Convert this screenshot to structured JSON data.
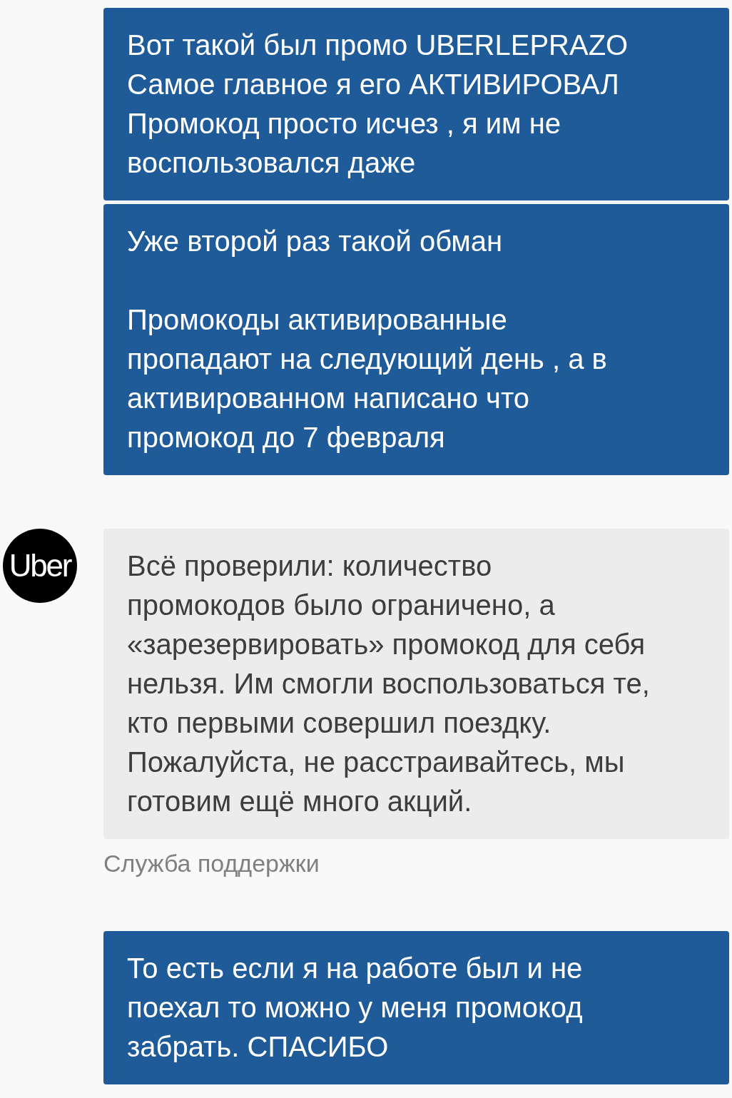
{
  "messages": [
    {
      "kind": "outgoing",
      "text": "Вот такой был промо UBERLEPRAZO\nСамое главное я его АКТИВИРОВАЛ\nПромокод просто исчез , я им не\nвоспользовался даже"
    },
    {
      "kind": "outgoing",
      "text": "Уже второй раз такой обман\n\nПромокоды активированные\nпропадают на следующий день , а в\nактивированном написано что\nпромокод до 7 февраля"
    },
    {
      "kind": "incoming",
      "avatar": "Uber",
      "text": "Всё проверили: количество\nпромокодов было ограничено, а\n«зарезервировать» промокод для себя\nнельзя. Им смогли воспользоваться те,\nкто первыми совершил поездку.\nПожалуйста, не расстраивайтесь, мы\nготовим ещё много акций.",
      "author": "Служба поддержки"
    },
    {
      "kind": "outgoing",
      "text": "То есть если я на работе был и не\nпоехал то можно у меня промокод\nзабрать. СПАСИБО"
    }
  ]
}
